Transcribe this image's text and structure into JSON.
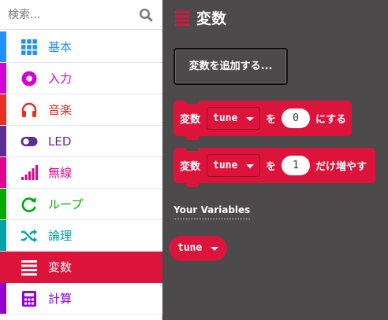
{
  "search": {
    "placeholder": "検索..."
  },
  "categories": [
    {
      "label": "基本",
      "color": "#1e90ff",
      "icon": "grid-icon"
    },
    {
      "label": "入力",
      "color": "#d400d4",
      "icon": "record-icon"
    },
    {
      "label": "音楽",
      "color": "#e63022",
      "icon": "headphones-icon"
    },
    {
      "label": "LED",
      "color": "#5c2d91",
      "icon": "toggle-icon"
    },
    {
      "label": "無線",
      "color": "#e3008c",
      "icon": "signal-icon"
    },
    {
      "label": "ループ",
      "color": "#00aa00",
      "icon": "refresh-icon"
    },
    {
      "label": "論理",
      "color": "#00a4a6",
      "icon": "shuffle-icon"
    },
    {
      "label": "変数",
      "color": "#dc143c",
      "icon": "list-icon"
    },
    {
      "label": "計算",
      "color": "#9400d3",
      "icon": "calculator-icon"
    }
  ],
  "flyout": {
    "title": "変数",
    "make_variable_label": "変数を追加する...",
    "set_block": {
      "prefix": "変数",
      "variable": "tune",
      "middle": "を",
      "value": "0",
      "suffix": "にする"
    },
    "change_block": {
      "prefix": "変数",
      "variable": "tune",
      "middle": "を",
      "value": "1",
      "suffix": "だけ増やす"
    },
    "your_variables_label": "Your Variables",
    "variables": [
      "tune"
    ]
  }
}
